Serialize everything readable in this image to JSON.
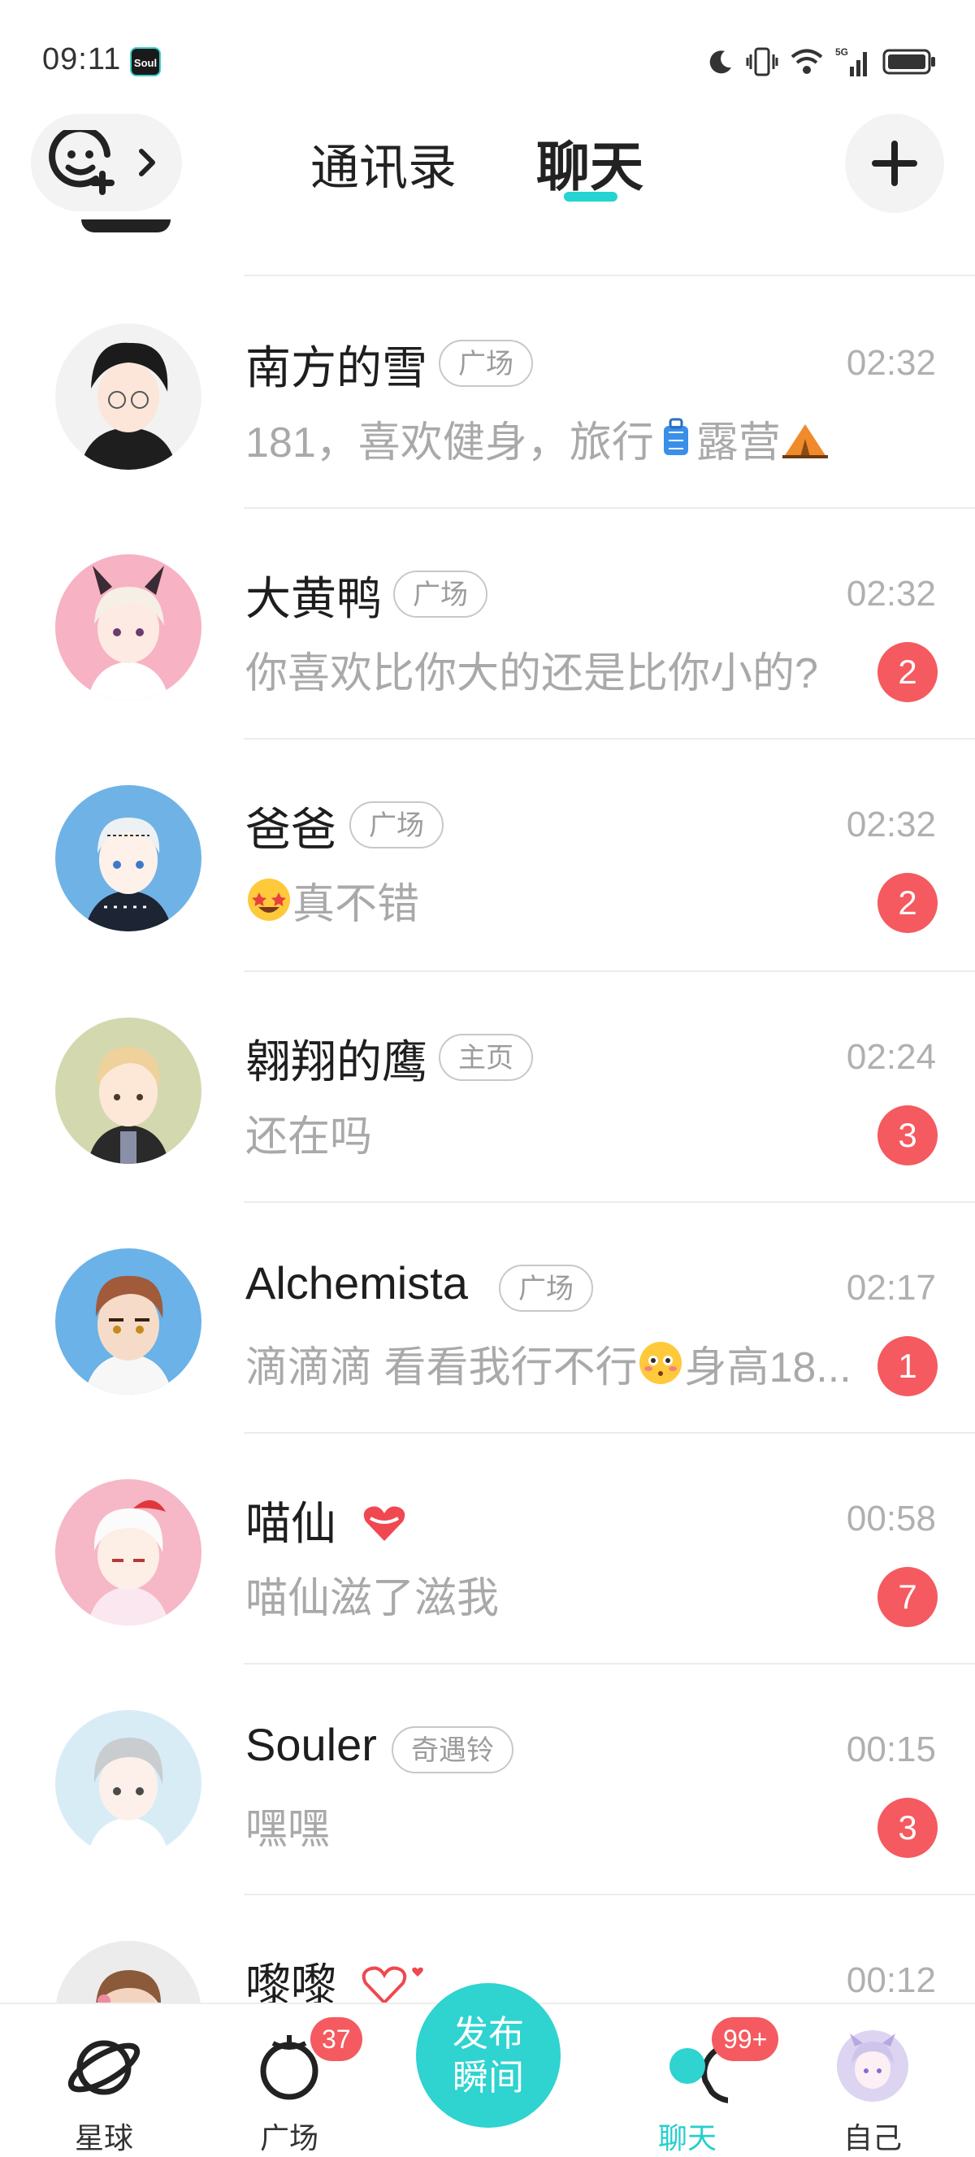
{
  "status_bar": {
    "time": "09:11",
    "app_badge": "Soul",
    "network": "5G"
  },
  "header": {
    "tabs": [
      {
        "label": "通讯录"
      },
      {
        "label": "聊天"
      }
    ],
    "active_tab": "聊天"
  },
  "chats": [
    {
      "name": "南方的雪",
      "tag": "广场",
      "time": "02:32",
      "message": "181，喜欢健身，旅行",
      "message_tail": "露营",
      "unread": null
    },
    {
      "name": "大黄鸭",
      "tag": "广场",
      "time": "02:32",
      "message": "你喜欢比你大的还是比你小的?",
      "unread": "2"
    },
    {
      "name": "爸爸",
      "tag": "广场",
      "time": "02:32",
      "message": "真不错",
      "unread": "2"
    },
    {
      "name": "翱翔的鹰",
      "tag": "主页",
      "time": "02:24",
      "message": "还在吗",
      "unread": "3"
    },
    {
      "name": "Alchemista",
      "tag": "广场",
      "time": "02:17",
      "message": "滴滴滴 看看我行不行",
      "message_tail": "身高18...",
      "unread": "1"
    },
    {
      "name": "喵仙",
      "tag": "",
      "time": "00:58",
      "message": "喵仙滋了滋我",
      "unread": "7"
    },
    {
      "name": "Souler",
      "tag": "奇遇铃",
      "time": "00:15",
      "message": "嘿嘿",
      "unread": "3"
    },
    {
      "name": "嚟嚟",
      "tag": "",
      "time": "00:12",
      "message": "",
      "unread": null
    }
  ],
  "bottom_nav": {
    "items": [
      {
        "label": "星球",
        "badge": ""
      },
      {
        "label": "广场",
        "badge": "37"
      },
      {
        "label": "聊天",
        "badge": "99+"
      },
      {
        "label": "自己",
        "badge": ""
      }
    ],
    "publish_label_line1": "发布",
    "publish_label_line2": "瞬间"
  },
  "colors": {
    "accent": "#25d4d0",
    "badge": "#f45a5f",
    "muted": "#a9a9a9"
  }
}
